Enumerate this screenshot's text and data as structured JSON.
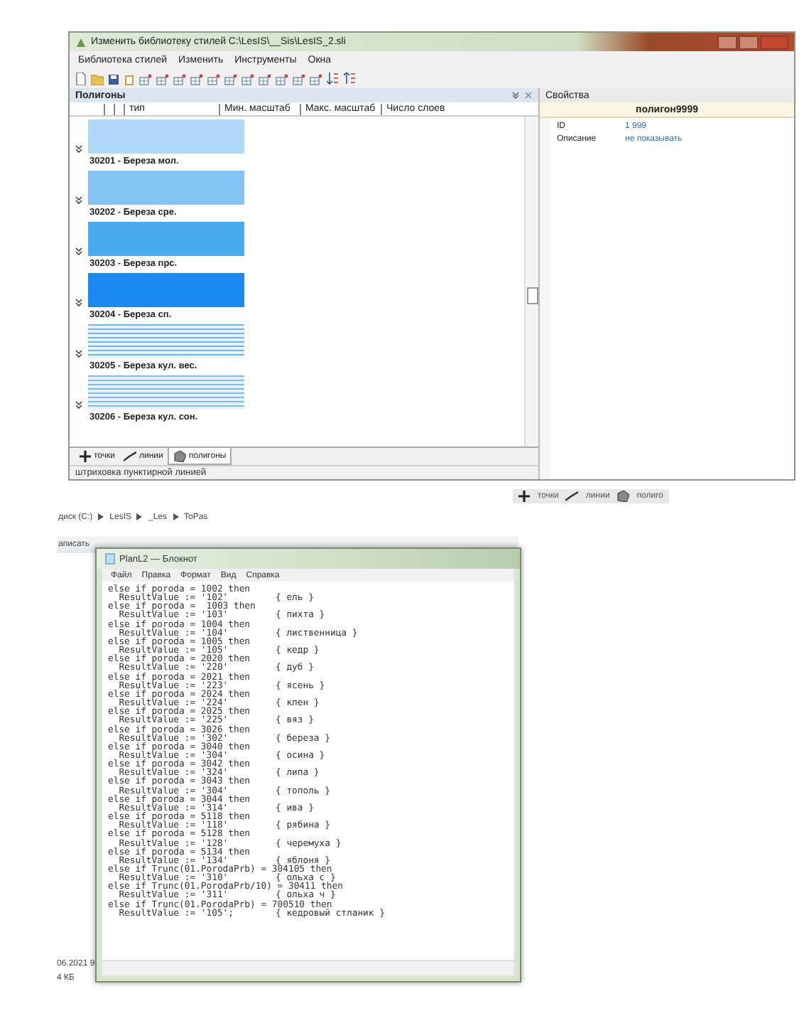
{
  "style_window": {
    "title": "Изменить библиотеку стилей C:\\LesIS\\__Sis\\LesIS_2.sli",
    "menu": [
      "Библиотека стилей",
      "Изменить",
      "Инструменты",
      "Окна"
    ],
    "panel": {
      "title": "Полигоны",
      "columns": [
        "тип",
        "Мин. масштаб",
        "Макс. масштаб",
        "Число слоев"
      ],
      "items": [
        {
          "label": "30201 - Береза мол.",
          "kind": "solid",
          "color": "#b0d8f8"
        },
        {
          "label": "30202 - Береза сре.",
          "kind": "solid",
          "color": "#84c4f4"
        },
        {
          "label": "30203 - Береза прс.",
          "kind": "solid",
          "color": "#4aaaf0"
        },
        {
          "label": "30204 - Береза сп.",
          "kind": "solid",
          "color": "#1a8af0"
        },
        {
          "label": "30205 - Береза кул. вес.",
          "kind": "hatched",
          "color": "#6fb2ec"
        },
        {
          "label": "30206 - Береза кул. сон.",
          "kind": "hatched",
          "color": "#7dbcf0"
        }
      ]
    },
    "tabs": [
      {
        "label": "точки",
        "kind": "points",
        "selected": false
      },
      {
        "label": "линии",
        "kind": "lines",
        "selected": false
      },
      {
        "label": "полигоны",
        "kind": "polygons",
        "selected": true
      }
    ],
    "status": "штриховка пунктирной линией",
    "properties": {
      "title": "Свойства",
      "header": "полигон9999",
      "rows": [
        {
          "name": "ID",
          "value": "1 999"
        },
        {
          "name": "Описание",
          "value": "не показывать"
        }
      ]
    }
  },
  "background_tabs": [
    "точки",
    "линии",
    "полиго"
  ],
  "explorer": {
    "breadcrumb": [
      "диск (C:)",
      "LesIS",
      "_Les",
      "ToPas"
    ],
    "toolbar_text": "аписать",
    "date": "06.2021 9",
    "size": "4 КБ"
  },
  "notepad": {
    "title": "PlanL2 — Блокнот",
    "menu": [
      "Файл",
      "Правка",
      "Формат",
      "Вид",
      "Справка"
    ],
    "lines": [
      {
        "code": "else if poroda = 1002 then"
      },
      {
        "code": "  ResultValue := '102'",
        "comment": "{ ель }"
      },
      {
        "code": "else if poroda =  1003 then"
      },
      {
        "code": "  ResultValue := '103'",
        "comment": "{ пихта }"
      },
      {
        "code": "else if poroda = 1004 then"
      },
      {
        "code": "  ResultValue := '104'",
        "comment": "{ лиственница }"
      },
      {
        "code": "else if poroda = 1005 then"
      },
      {
        "code": "  ResultValue := '105'",
        "comment": "{ кедр }"
      },
      {
        "code": "else if poroda = 2020 then"
      },
      {
        "code": "  ResultValue := '220'",
        "comment": "{ дуб }"
      },
      {
        "code": "else if poroda = 2021 then"
      },
      {
        "code": "  ResultValue := '223'",
        "comment": "{ ясень }"
      },
      {
        "code": "else if poroda = 2024 then"
      },
      {
        "code": "  ResultValue := '224'",
        "comment": "{ клен }"
      },
      {
        "code": "else if poroda = 2025 then"
      },
      {
        "code": "  ResultValue := '225'",
        "comment": "{ вяз }"
      },
      {
        "code": "else if poroda = 3026 then"
      },
      {
        "code": "  ResultValue := '302'",
        "comment": "{ береза }"
      },
      {
        "code": "else if poroda = 3040 then"
      },
      {
        "code": "  ResultValue := '304'",
        "comment": "{ осина }"
      },
      {
        "code": "else if poroda = 3042 then"
      },
      {
        "code": "  ResultValue := '324'",
        "comment": "{ липа }"
      },
      {
        "code": "else if poroda = 3043 then"
      },
      {
        "code": "  ResultValue := '304'",
        "comment": "{ тополь }"
      },
      {
        "code": "else if poroda = 3044 then"
      },
      {
        "code": "  ResultValue := '314'",
        "comment": "{ ива }"
      },
      {
        "code": "else if poroda = 5118 then"
      },
      {
        "code": "  ResultValue := '118'",
        "comment": "{ рябина }"
      },
      {
        "code": "else if poroda = 5128 then"
      },
      {
        "code": "  ResultValue := '128'",
        "comment": "{ черемуха }"
      },
      {
        "code": "else if poroda = 5134 then"
      },
      {
        "code": "  ResultValue := '134'",
        "comment": "{ яблоня }"
      },
      {
        "code": "else if Trunc(01.PorodaPrb) = 304105 then"
      },
      {
        "code": "  ResultValue := '310'",
        "comment": "{ ольха с }"
      },
      {
        "code": "else if Trunc(01.PorodaPrb/10) = 30411 then"
      },
      {
        "code": "  ResultValue := '311'",
        "comment": "{ ольха ч }"
      },
      {
        "code": "else if Trunc(01.PorodaPrb) = 700510 then"
      },
      {
        "code": "  ResultValue := '105';",
        "comment": "{ кедровый стланик }"
      }
    ]
  }
}
